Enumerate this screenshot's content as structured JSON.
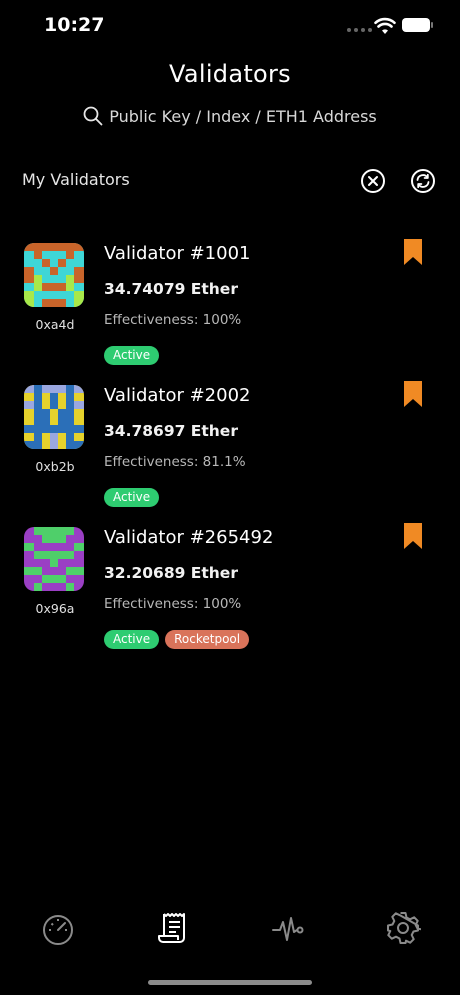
{
  "status_bar": {
    "time": "10:27"
  },
  "header": {
    "title": "Validators",
    "search_placeholder": "Public Key / Index / ETH1 Address"
  },
  "section": {
    "label": "My Validators"
  },
  "validators": [
    {
      "name": "Validator #1001",
      "balance": "34.74079 Ether",
      "effectiveness": "Effectiveness: 100%",
      "short_key": "0xa4d",
      "badges": [
        "Active"
      ]
    },
    {
      "name": "Validator #2002",
      "balance": "34.78697 Ether",
      "effectiveness": "Effectiveness: 81.1%",
      "short_key": "0xb2b",
      "badges": [
        "Active"
      ]
    },
    {
      "name": "Validator #265492",
      "balance": "32.20689 Ether",
      "effectiveness": "Effectiveness: 100%",
      "short_key": "0x96a",
      "badges": [
        "Active",
        "Rocketpool"
      ]
    }
  ],
  "icons": {
    "search": "search-icon",
    "clear": "close-circle-icon",
    "refresh": "refresh-icon",
    "bookmark": "bookmark-icon",
    "tabs": [
      "dashboard-gauge-icon",
      "receipt-list-icon",
      "activity-pulse-icon",
      "settings-gear-icon"
    ]
  },
  "colors": {
    "background": "#000000",
    "active_badge": "#2ecc71",
    "rocketpool_badge": "#d9735a",
    "bookmark": "#f08a24",
    "selected_tab": "#ffffff",
    "inactive_tab": "#8a8a8a"
  }
}
